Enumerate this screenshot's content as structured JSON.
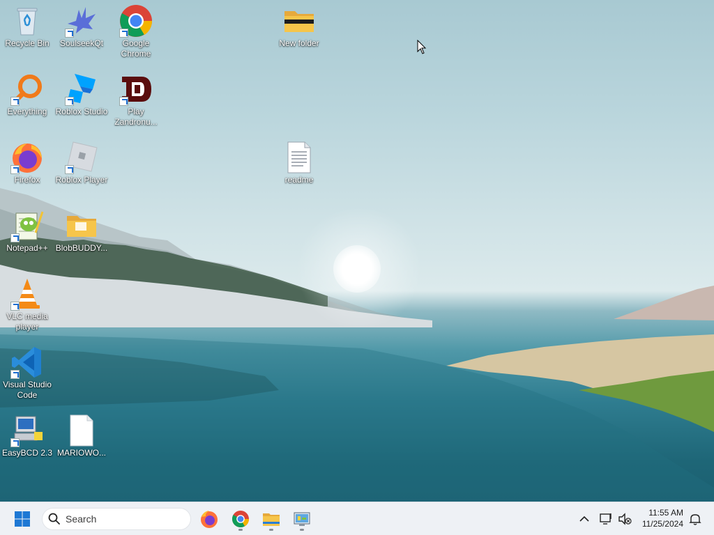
{
  "desktop": {
    "icons": [
      {
        "label": "Recycle Bin"
      },
      {
        "label": "SoulseekQt"
      },
      {
        "label": "Google Chrome"
      },
      {
        "label": "New folder"
      },
      {
        "label": "Everything"
      },
      {
        "label": "Roblox Studio"
      },
      {
        "label": "Play Zandronu..."
      },
      {
        "label": "Firefox"
      },
      {
        "label": "Roblox Player"
      },
      {
        "label": "readme"
      },
      {
        "label": "Notepad++"
      },
      {
        "label": "BlobBUDDY..."
      },
      {
        "label": "VLC media player"
      },
      {
        "label": "Visual Studio Code"
      },
      {
        "label": "EasyBCD 2.3"
      },
      {
        "label": "MARIOWO..."
      }
    ]
  },
  "taskbar": {
    "search_placeholder": "Search",
    "pinned": [
      {
        "icon": "firefox-icon",
        "running": false
      },
      {
        "icon": "chrome-icon",
        "running": true
      },
      {
        "icon": "file-explorer-icon",
        "running": true
      },
      {
        "icon": "control-panel-icon",
        "running": true
      }
    ],
    "clock": {
      "time": "11:55 AM",
      "date": "11/25/2024"
    }
  },
  "colors": {
    "taskbar_bg": "#eef1f5",
    "start_blue": "#1d78d4",
    "folder_yellow": "#f6c54a"
  }
}
